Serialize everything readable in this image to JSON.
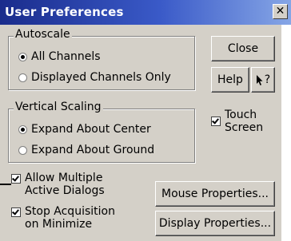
{
  "window": {
    "title": "User Preferences",
    "close_glyph": "✕"
  },
  "autoscale": {
    "legend": "Autoscale",
    "options": [
      "All Channels",
      "Displayed Channels Only"
    ],
    "selected": 0
  },
  "vertical_scaling": {
    "legend": "Vertical Scaling",
    "options": [
      "Expand About Center",
      "Expand About Ground"
    ],
    "selected": 0
  },
  "buttons": {
    "close": "Close",
    "help": "Help",
    "whats_this_glyph": "?",
    "mouse_properties": "Mouse Properties...",
    "display_properties": "Display Properties..."
  },
  "touch_screen": {
    "label_line1": "Touch",
    "label_line2": "Screen",
    "checked": true
  },
  "allow_multiple": {
    "label_line1": "Allow Multiple",
    "label_line2": "Active Dialogs",
    "checked": true
  },
  "stop_acquisition": {
    "label_line1": "Stop Acquisition",
    "label_line2": "on Minimize",
    "checked": true
  }
}
